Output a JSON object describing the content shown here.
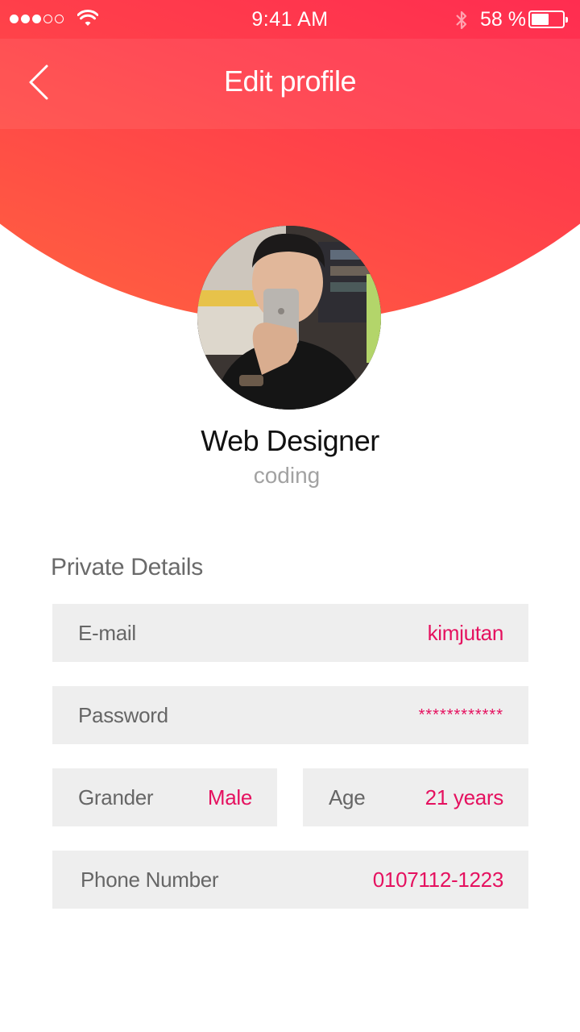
{
  "status_bar": {
    "time": "9:41 AM",
    "battery_percent": "58 %",
    "battery_level": 0.58,
    "signal_bars_filled": 3,
    "signal_bars_total": 5
  },
  "header": {
    "title": "Edit profile",
    "back_icon": "chevron-left-icon"
  },
  "profile": {
    "name": "Web Designer",
    "subtitle": "coding"
  },
  "private_details": {
    "title": "Private Details",
    "email": {
      "label": "E-mail",
      "value": "kimjutan"
    },
    "password": {
      "label": "Password",
      "value": "************"
    },
    "gender": {
      "label": "Grander",
      "value": "Male"
    },
    "age": {
      "label": "Age",
      "value": "21 years"
    },
    "phone": {
      "label": "Phone Number",
      "value": "0107112-1223"
    }
  },
  "colors": {
    "accent": "#e5115f",
    "gradient_start": "#ff6a3d",
    "gradient_end": "#ff0a5e",
    "field_bg": "#eeeeee"
  }
}
